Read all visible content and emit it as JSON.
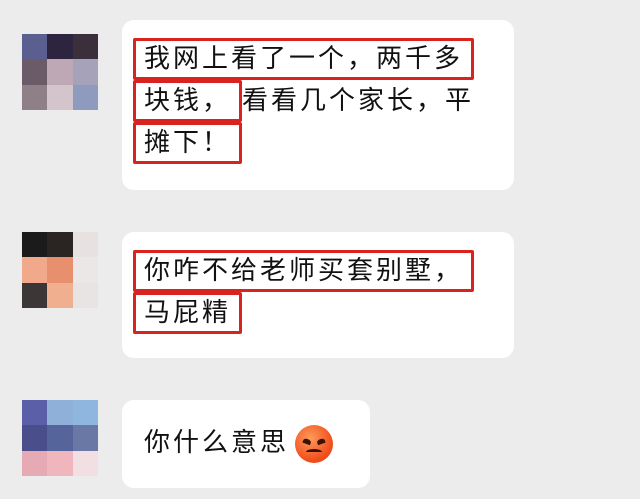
{
  "messages": [
    {
      "lines": [
        {
          "boxed_prefix": "我网上看了一个，两千多",
          "rest": ""
        },
        {
          "boxed_prefix": "块钱，",
          "rest": "看看几个家长，平"
        },
        {
          "boxed_prefix": "摊下！",
          "rest": ""
        }
      ]
    },
    {
      "lines": [
        {
          "boxed_prefix": "你咋不给老师买套别墅，",
          "rest": ""
        },
        {
          "boxed_prefix": "马屁精",
          "rest": ""
        }
      ]
    },
    {
      "lines": [
        {
          "boxed_prefix": "",
          "rest": "你什么意思"
        }
      ],
      "emoji": "angry-face-icon"
    }
  ],
  "colors": {
    "background": "#ececec",
    "bubble": "#ffffff",
    "highlight_box": "#d9231f"
  }
}
